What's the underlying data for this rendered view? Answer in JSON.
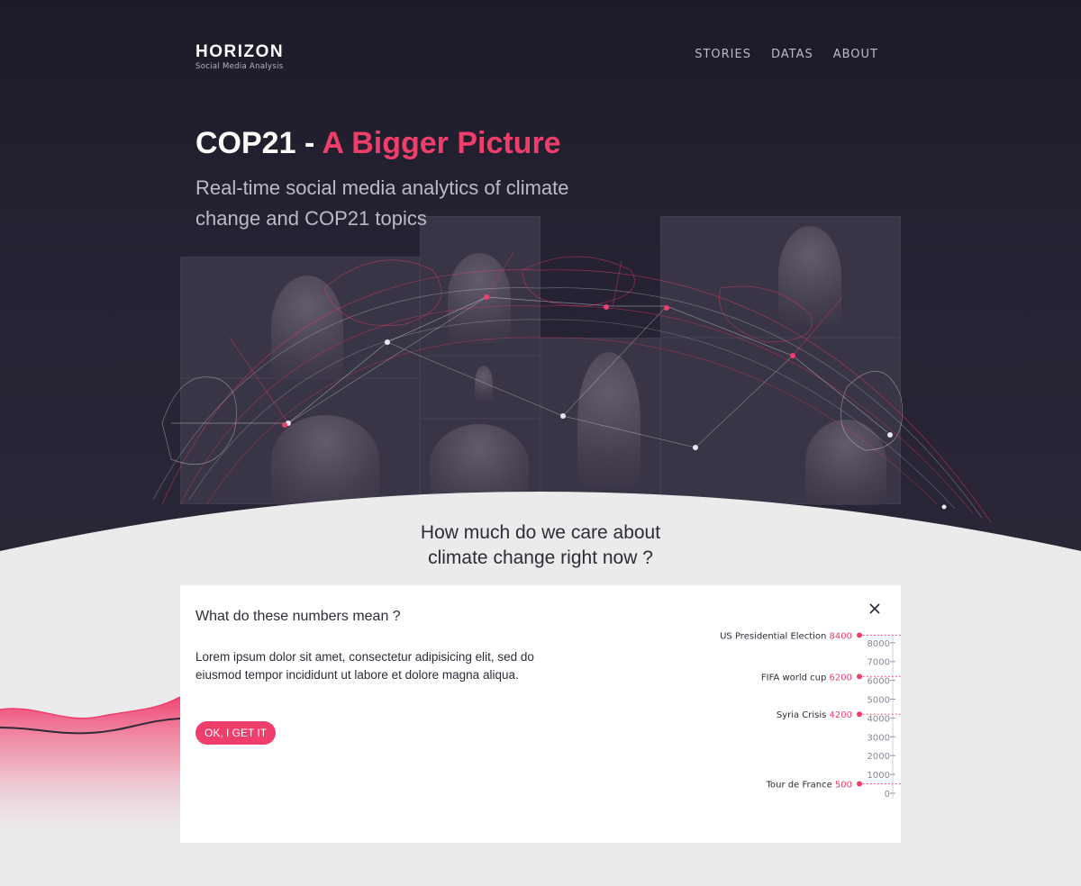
{
  "brand": {
    "name": "HORIZON",
    "tagline": "Social Media Analysis"
  },
  "nav": [
    {
      "label": "STORIES"
    },
    {
      "label": "DATAS"
    },
    {
      "label": "ABOUT"
    }
  ],
  "hero": {
    "title_main": "COP21 - ",
    "title_accent": "A Bigger Picture",
    "subtitle": "Real-time social media analytics of climate change and COP21 topics"
  },
  "question": {
    "line1": "How much do we care about",
    "line2": "climate change right now ?"
  },
  "panel": {
    "title": "What do these numbers mean ?",
    "body": "Lorem ipsum dolor sit amet, consectetur adipisicing elit, sed do eiusmod tempor incididunt ut labore et dolore magna aliqua.",
    "button": "OK, I GET IT"
  },
  "colors": {
    "accent": "#f03e6c",
    "dark": "#2e2b39",
    "hero_bg": "#231f2e"
  },
  "icons": {
    "close": "close-icon"
  },
  "chart_data": {
    "type": "scatter",
    "ticks": [
      8000,
      7000,
      6000,
      5000,
      4000,
      3000,
      2000,
      1000,
      0
    ],
    "ylim": [
      0,
      8000
    ],
    "events": [
      {
        "name": "US Presidential Election",
        "value": 8400
      },
      {
        "name": "FIFA world cup",
        "value": 6200
      },
      {
        "name": "Syria Crisis",
        "value": 4200
      },
      {
        "name": "Tour de France",
        "value": 500
      }
    ]
  }
}
